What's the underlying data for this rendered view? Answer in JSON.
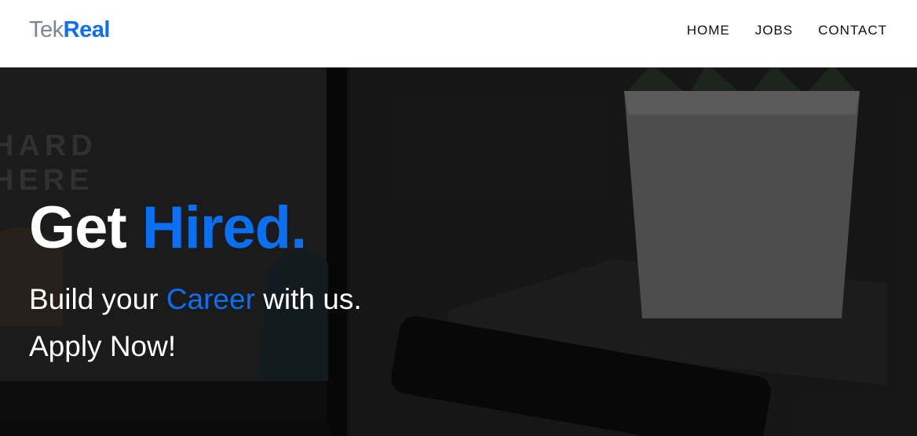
{
  "brand": {
    "part1": "Tek",
    "part2": "Real"
  },
  "nav": {
    "home": "HOME",
    "jobs": "JOBS",
    "contact": "CONTACT"
  },
  "hero": {
    "headline_part1": "Get ",
    "headline_accent": "Hired.",
    "line1_part1": "Build your ",
    "line1_accent": "Career",
    "line1_part2": " with us.",
    "line2": "Apply Now!",
    "bg_sign_line1": "HARD",
    "bg_sign_line2": "HERE"
  },
  "colors": {
    "accent": "#0b6ff2",
    "brand_muted": "#7d8590",
    "nav_text": "#111111"
  }
}
